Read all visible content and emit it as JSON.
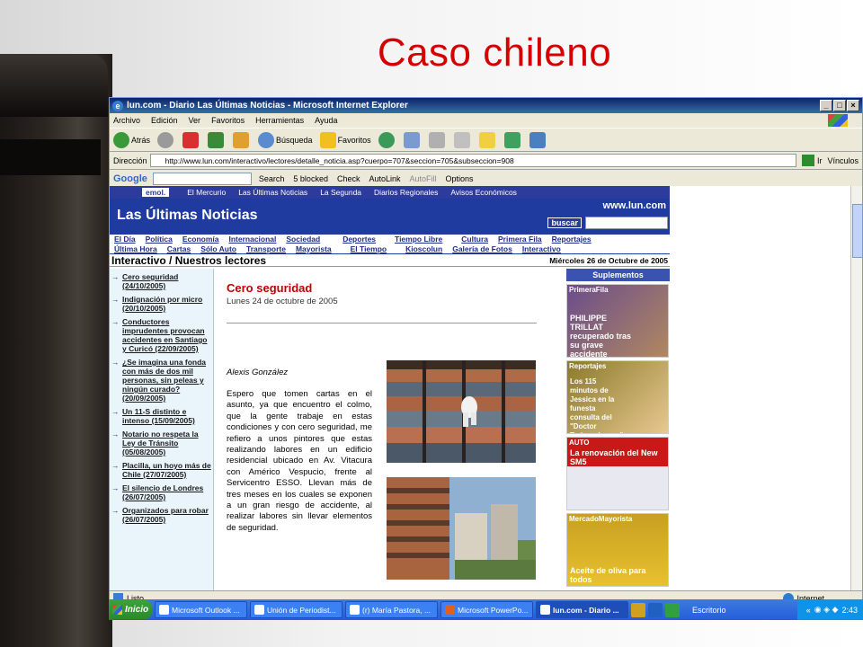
{
  "slide": {
    "title": "Caso chileno"
  },
  "window": {
    "title": "lun.com - Diario Las Últimas Noticias - Microsoft Internet Explorer"
  },
  "menu": [
    "Archivo",
    "Edición",
    "Ver",
    "Favoritos",
    "Herramientas",
    "Ayuda"
  ],
  "toolbar": {
    "back": "Atrás",
    "search": "Búsqueda",
    "favorites": "Favoritos"
  },
  "address": {
    "label": "Dirección",
    "url": "http://www.lun.com/interactivo/lectores/detalle_noticia.asp?cuerpo=707&seccion=705&subseccion=908",
    "go": "Ir",
    "links": "Vínculos"
  },
  "google": {
    "logo": "Google",
    "search": "Search",
    "blocked": "5 blocked",
    "check": "Check",
    "autolink": "AutoLink",
    "autofill": "AutoFill",
    "options": "Options"
  },
  "site": {
    "emol_bar": [
      "El Mercurio",
      "Las Últimas Noticias",
      "La Segunda",
      "Diarios Regionales",
      "Avisos Económicos"
    ],
    "emol_logo": "emol.",
    "brand": "Las Últimas Noticias",
    "www": "www.lun.com",
    "buscar": "buscar",
    "nav1": [
      "El Día",
      "Política",
      "Economía",
      "Internacional",
      "Sociedad",
      "Deportes",
      "Tiempo Libre",
      "Cultura",
      "Primera Fila",
      "Reportajes"
    ],
    "nav2": [
      "Última Hora",
      "Cartas",
      "Sólo Auto",
      "Transporte",
      "Mayorista",
      "El Tiempo",
      "Kioscolun",
      "Galería de Fotos",
      "Interactivo"
    ],
    "section": "Interactivo / Nuestros lectores",
    "date": "Miércoles 26 de Octubre de 2005",
    "left_items": [
      "Cero seguridad (24/10/2005)",
      "Indignación por micro (20/10/2005)",
      "Conductores imprudentes provocan accidentes en Santiago y Curicó (22/09/2005)",
      "¿Se imagina una fonda con más de dos mil personas, sin peleas y ningún curado? (20/09/2005)",
      "Un 11-S distinto e intenso (15/09/2005)",
      "Notario no respeta la Ley de Tránsito (05/08/2005)",
      "Placilla, un hoyo más de Chile (27/07/2005)",
      "El silencio de Londres (26/07/2005)",
      "Organizados para robar (26/07/2005)"
    ],
    "article": {
      "title": "Cero seguridad",
      "date": "Lunes 24 de octubre de 2005",
      "author": "Alexis González",
      "body": "Espero que tomen cartas en el asunto, ya que encuentro el colmo, que la gente trabaje en estas condiciones y con cero seguridad, me refiero a unos pintores que estas realizando labores en un edificio residencial ubicado en Av. Vitacura con Américo Vespucio, frente al Servicentro ESSO. Llevan más de tres meses en los cuales se exponen a un gran riesgo de accidente, al realizar labores sin llevar elementos de seguridad."
    },
    "right": {
      "header": "Suplementos",
      "ads": [
        {
          "cap": "PrimeraFila",
          "text": "PHILIPPE TRILLAT recuperado tras su grave accidente",
          "color": "#6a4c8c"
        },
        {
          "cap": "Reportajes",
          "text": "Los 115 minutos de Jessica en la funesta consulta del \"Doctor Todopoderoso\"",
          "color": "#8b7a2a"
        },
        {
          "cap": "AUTO",
          "text": "La renovación del New SM5",
          "color": "#c81818"
        },
        {
          "cap": "MercadoMayorista",
          "text": "Aceite de oliva para todos",
          "color": "#c8a020"
        }
      ]
    }
  },
  "status": {
    "text": "Listo",
    "zone": "Internet"
  },
  "taskbar": {
    "start": "Inicio",
    "items": [
      "Microsoft Outlook ...",
      "Unión de Periodist...",
      "(r) María Pastora, ...",
      "Microsoft PowerPo...",
      "lun.com - Diario ..."
    ],
    "desk": "Escritorio",
    "time": "2:43"
  }
}
